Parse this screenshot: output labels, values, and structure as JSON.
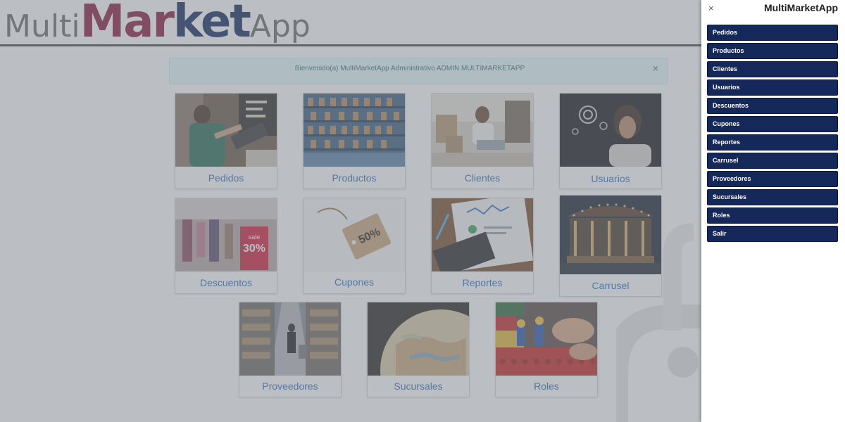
{
  "header": {
    "logo": {
      "part1": "Multi",
      "part2": "Mar",
      "part3": "ket",
      "part4": "App"
    }
  },
  "alert": {
    "message": "Bienvenido(a) MultiMarketApp Administrativo ADMIN MULTIMARKETAPP",
    "close_label": "×"
  },
  "cards": [
    {
      "label": "Pedidos"
    },
    {
      "label": "Productos"
    },
    {
      "label": "Clientes"
    },
    {
      "label": "Usuarios"
    },
    {
      "label": "Descuentos"
    },
    {
      "label": "Cupones"
    },
    {
      "label": "Reportes"
    },
    {
      "label": "Carrusel"
    },
    {
      "label": "Proveedores"
    },
    {
      "label": "Sucursales"
    },
    {
      "label": "Roles"
    }
  ],
  "sidemenu": {
    "title": "MultiMarketApp",
    "close_label": "×",
    "items": [
      {
        "label": "Pedidos"
      },
      {
        "label": "Productos"
      },
      {
        "label": "Clientes"
      },
      {
        "label": "Usuarios"
      },
      {
        "label": "Descuentos"
      },
      {
        "label": "Cupones"
      },
      {
        "label": "Reportes"
      },
      {
        "label": "Carrusel"
      },
      {
        "label": "Proveedores"
      },
      {
        "label": "Sucursales"
      },
      {
        "label": "Roles"
      },
      {
        "label": "Salir"
      }
    ]
  },
  "colors": {
    "menu_bg": "#14285a",
    "logo_red": "#8b1a3d",
    "logo_navy": "#14295e",
    "card_label": "#2f6ebd"
  }
}
